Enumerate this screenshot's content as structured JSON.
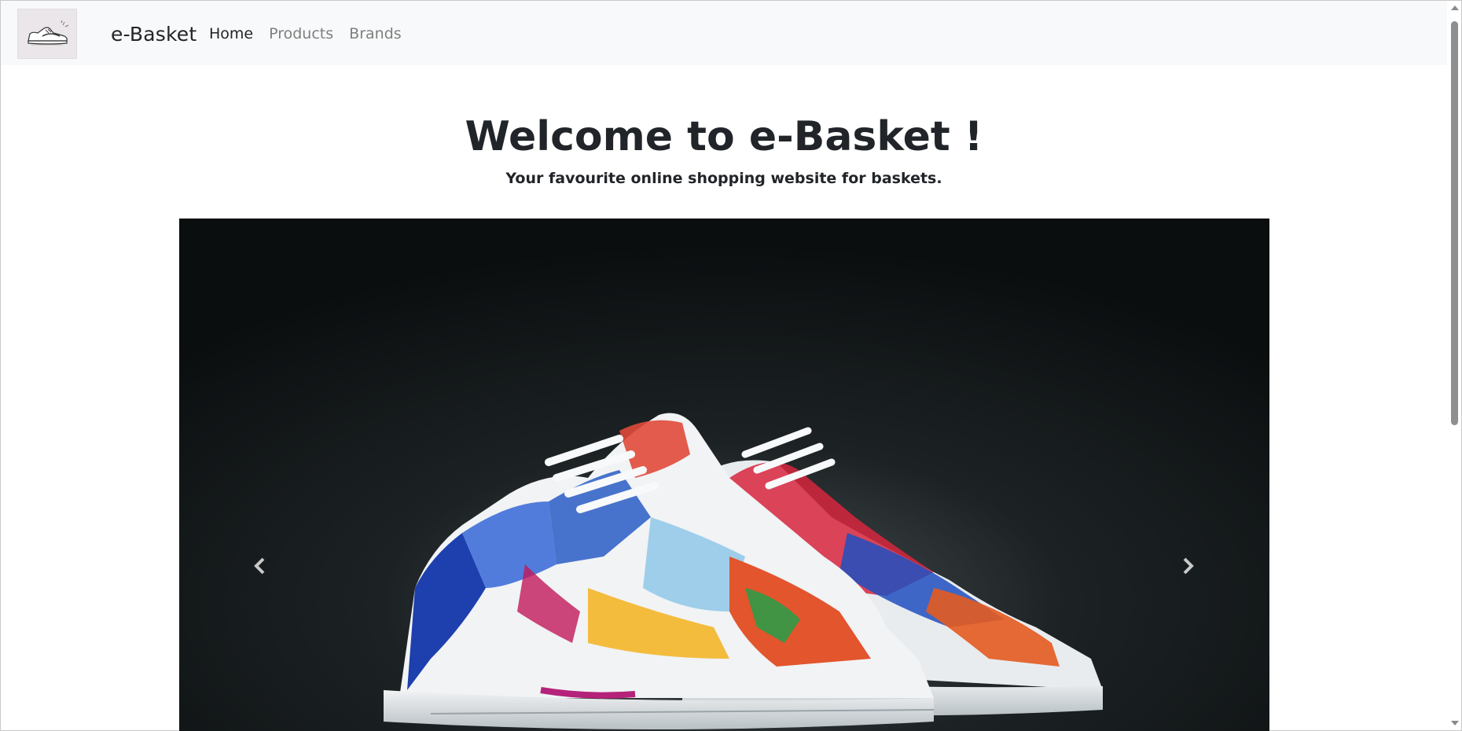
{
  "navbar": {
    "logo_icon": "sneaker-logo-icon",
    "brand": "e-Basket",
    "links": [
      {
        "label": "Home",
        "active": true
      },
      {
        "label": "Products",
        "active": false
      },
      {
        "label": "Brands",
        "active": false
      }
    ]
  },
  "hero": {
    "title": "Welcome to e-Basket !",
    "subtitle": "Your favourite online shopping website for baskets."
  },
  "carousel": {
    "prev_icon": "chevron-left-icon",
    "next_icon": "chevron-right-icon"
  },
  "colors": {
    "navbar_bg": "#f8f9fa",
    "text": "#212529",
    "muted_link": "#7f7f7f",
    "carousel_bg": "#0d1011"
  }
}
